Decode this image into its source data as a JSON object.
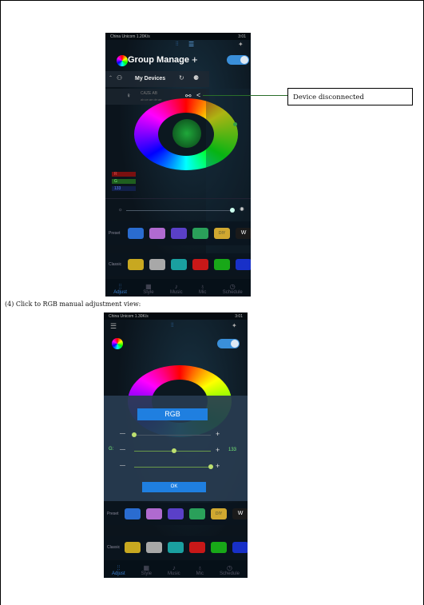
{
  "callout": {
    "text": "Device disconnected"
  },
  "caption": "(4) Click to RGB manual adjustment view:",
  "screen1": {
    "status": {
      "carrier": "China Unicom",
      "speed": "1.20K/s",
      "time": "3:01"
    },
    "title": "Group Manage",
    "add_symbol": "+",
    "my_devices": "My Devices",
    "device_name": "CAZE AB",
    "device_sub": "ab:ce:ae:de:ae",
    "rgb_labels": [
      "R",
      "G",
      "133"
    ],
    "preset_label": "Preset",
    "classic_label": "Classic",
    "preset_text_a": "DIY",
    "preset_text_b": "W",
    "colors": {
      "accent": "#3a8fd9",
      "green": "#7ed321"
    }
  },
  "screen2": {
    "status": {
      "carrier": "China Unicom",
      "speed": "1.30K/s",
      "time": "3:01"
    },
    "dialog_title": "RGB",
    "rows": [
      {
        "label": "",
        "minus": "—",
        "plus": "+",
        "value": "",
        "level": 0.0
      },
      {
        "label": "G:",
        "minus": "—",
        "plus": "+",
        "value": "133",
        "level": 0.52
      },
      {
        "label": "",
        "minus": "—",
        "plus": "+",
        "value": "",
        "level": 1.0
      }
    ],
    "ok_label": "OK",
    "preset_label": "Preset",
    "classic_label": "Classic",
    "preset_text_a": "DIY",
    "preset_text_b": "W"
  },
  "nav": {
    "items": [
      "Adjust",
      "Style",
      "Music",
      "Mic",
      "Schedule"
    ],
    "active": "Adjust"
  }
}
